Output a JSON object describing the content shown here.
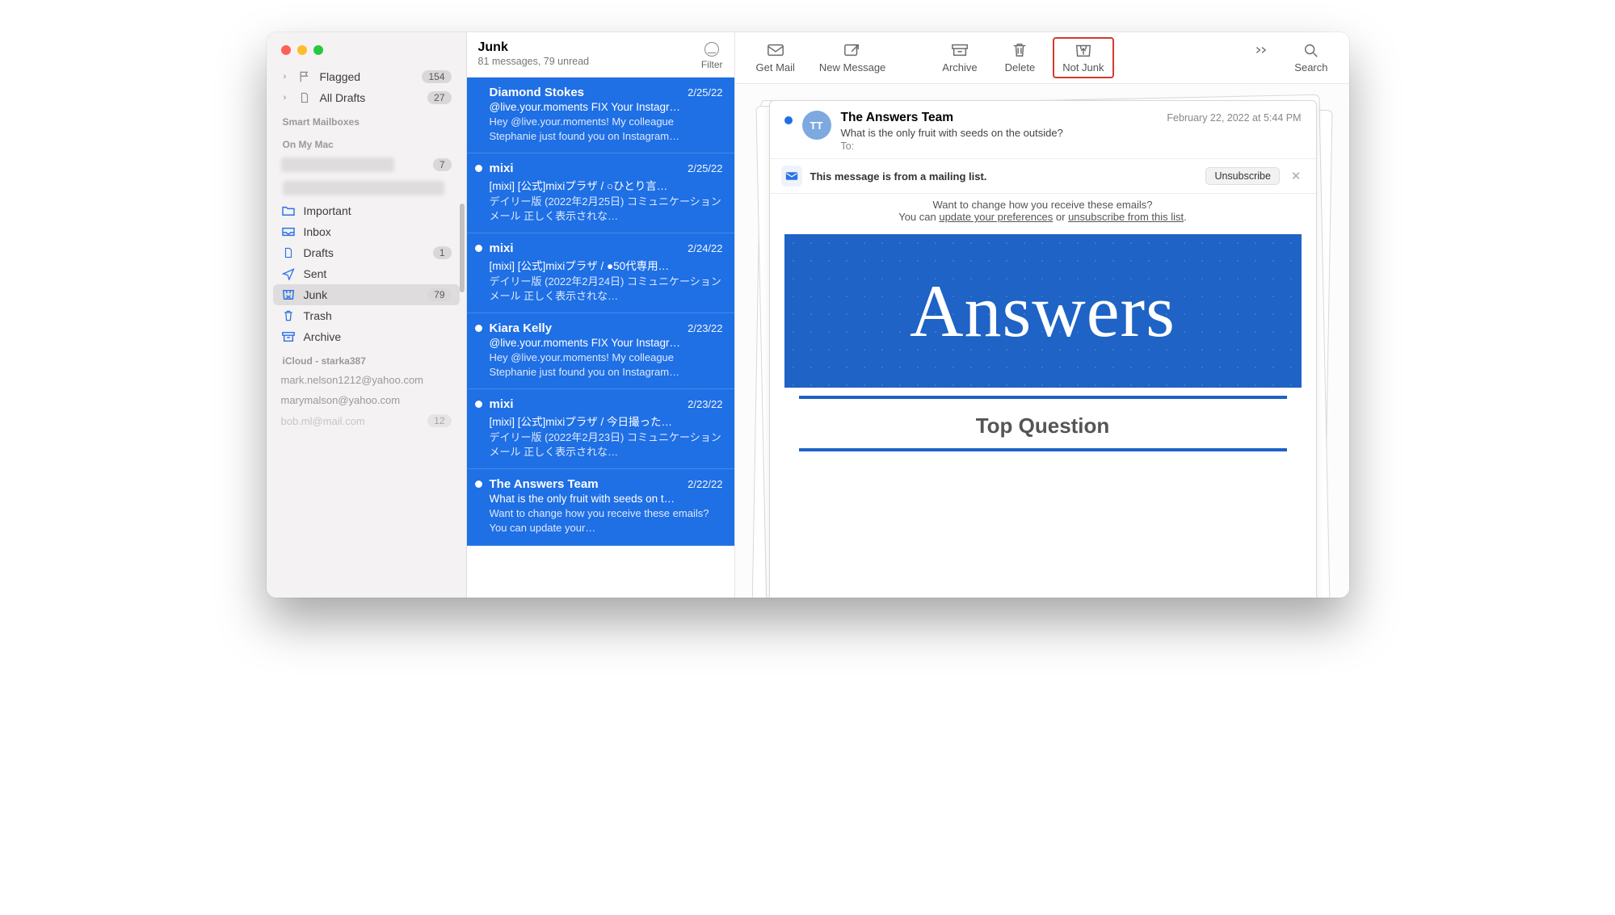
{
  "sidebar": {
    "top": [
      {
        "label": "Flagged",
        "count": "154",
        "icon": "flag"
      },
      {
        "label": "All Drafts",
        "count": "27",
        "icon": "doc"
      }
    ],
    "sections": {
      "smart": "Smart Mailboxes",
      "onmymac": "On My Mac",
      "icloud": "iCloud - starka387"
    },
    "onmymac_count": "7",
    "mailboxes": [
      {
        "label": "Important",
        "icon": "folder"
      },
      {
        "label": "Inbox",
        "icon": "inbox"
      },
      {
        "label": "Drafts",
        "icon": "doc",
        "count": "1"
      },
      {
        "label": "Sent",
        "icon": "sent"
      },
      {
        "label": "Junk",
        "icon": "junk",
        "count": "79",
        "selected": true
      },
      {
        "label": "Trash",
        "icon": "trash"
      },
      {
        "label": "Archive",
        "icon": "archive"
      }
    ],
    "accounts": [
      "mark.nelson1212@yahoo.com",
      "marymalson@yahoo.com",
      "bob.ml@mail.com"
    ],
    "accounts_last_count": "12"
  },
  "listhead": {
    "title": "Junk",
    "sub": "81 messages, 79 unread",
    "filter": "Filter"
  },
  "messages": [
    {
      "sender": "Diamond Stokes",
      "date": "2/25/22",
      "subject": "@live.your.moments FIX Your Instagr…",
      "preview": "Hey @live.your.moments! My colleague Stephanie just found you on Instagram…",
      "unread": false
    },
    {
      "sender": "mixi",
      "date": "2/25/22",
      "subject": "[mixi] [公式]mixiプラザ / ○ひとり言…",
      "preview": "デイリー版 (2022年2月25日) コミュニケーションメール 正しく表示されな…",
      "unread": true
    },
    {
      "sender": "mixi",
      "date": "2/24/22",
      "subject": "[mixi] [公式]mixiプラザ / ●50代専用…",
      "preview": "デイリー版 (2022年2月24日) コミュニケーションメール 正しく表示されな…",
      "unread": true
    },
    {
      "sender": "Kiara Kelly",
      "date": "2/23/22",
      "subject": "@live.your.moments FIX Your Instagr…",
      "preview": "Hey @live.your.moments! My colleague Stephanie just found you on Instagram…",
      "unread": true
    },
    {
      "sender": "mixi",
      "date": "2/23/22",
      "subject": "[mixi] [公式]mixiプラザ / 今日撮った…",
      "preview": "デイリー版 (2022年2月23日) コミュニケーションメール 正しく表示されな…",
      "unread": true
    },
    {
      "sender": "The Answers Team",
      "date": "2/22/22",
      "subject": "What is the only fruit with seeds on t…",
      "preview": "Want to change how you receive these emails? You can update your…",
      "unread": true
    }
  ],
  "toolbar": {
    "getmail": "Get Mail",
    "newmsg": "New Message",
    "archive": "Archive",
    "delete": "Delete",
    "notjunk": "Not Junk",
    "search": "Search"
  },
  "reader": {
    "avatar": "TT",
    "from": "The Answers Team",
    "subject": "What is the only fruit with seeds on the outside?",
    "to_label": "To:",
    "when": "February 22, 2022 at 5:44 PM",
    "strip_text": "This message is from a mailing list.",
    "unsubscribe": "Unsubscribe",
    "body_line1": "Want to change how you receive these emails?",
    "body_line2a": "You can ",
    "body_link1": "update your preferences",
    "body_line2b": " or ",
    "body_link2": "unsubscribe from this list",
    "body_line2c": ".",
    "banner": "Answers",
    "topq": "Top Question"
  }
}
